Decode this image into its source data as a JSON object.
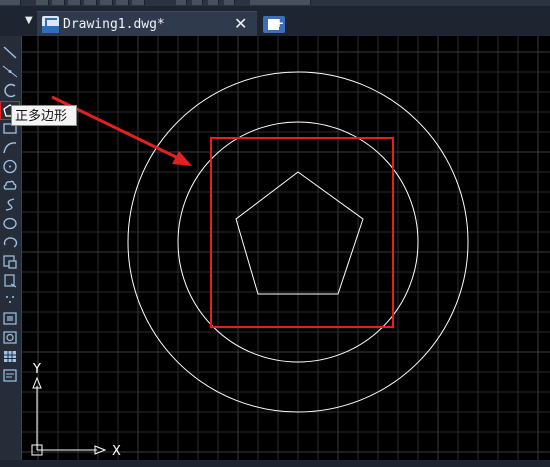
{
  "document_tab": {
    "title": "Drawing1.dwg*",
    "close_glyph": "✕",
    "icon": "dwg-file-icon"
  },
  "tab_menu_glyph": "▼",
  "new_tab_icon": "new-drawing-icon",
  "tooltip": {
    "text": "正多边形"
  },
  "toolbar": {
    "tools": [
      {
        "name": "line",
        "icon": "line-icon",
        "active": false
      },
      {
        "name": "construction-line",
        "icon": "construction-line-icon",
        "active": false
      },
      {
        "name": "polyline",
        "icon": "polyline-icon",
        "active": false
      },
      {
        "name": "polygon",
        "icon": "polygon-icon",
        "active": true
      },
      {
        "name": "rectangle",
        "icon": "rectangle-icon",
        "active": false
      },
      {
        "name": "arc",
        "icon": "arc-icon",
        "active": false
      },
      {
        "name": "circle",
        "icon": "circle-icon",
        "active": false
      },
      {
        "name": "revision-cloud",
        "icon": "revision-cloud-icon",
        "active": false
      },
      {
        "name": "spline",
        "icon": "spline-icon",
        "active": false
      },
      {
        "name": "ellipse",
        "icon": "ellipse-icon",
        "active": false
      },
      {
        "name": "ellipse-arc",
        "icon": "ellipse-arc-icon",
        "active": false
      },
      {
        "name": "insert-block",
        "icon": "insert-block-icon",
        "active": false
      },
      {
        "name": "make-block",
        "icon": "make-block-icon",
        "active": false
      },
      {
        "name": "point",
        "icon": "point-icon",
        "active": false
      },
      {
        "name": "hatch",
        "icon": "hatch-icon",
        "active": false
      },
      {
        "name": "region",
        "icon": "region-icon",
        "active": false
      },
      {
        "name": "table",
        "icon": "table-icon",
        "active": false
      },
      {
        "name": "multiline-text",
        "icon": "mtext-icon",
        "active": false
      }
    ]
  },
  "ucs": {
    "x_label": "X",
    "y_label": "Y"
  },
  "colors": {
    "canvas_background": "#000000",
    "grid_line": "#2c2c2c",
    "grid_major": "#3a3a3a",
    "drawing_stroke": "#ffffff",
    "annotation_red": "#e32020",
    "ui_dark": "#1e2530"
  }
}
